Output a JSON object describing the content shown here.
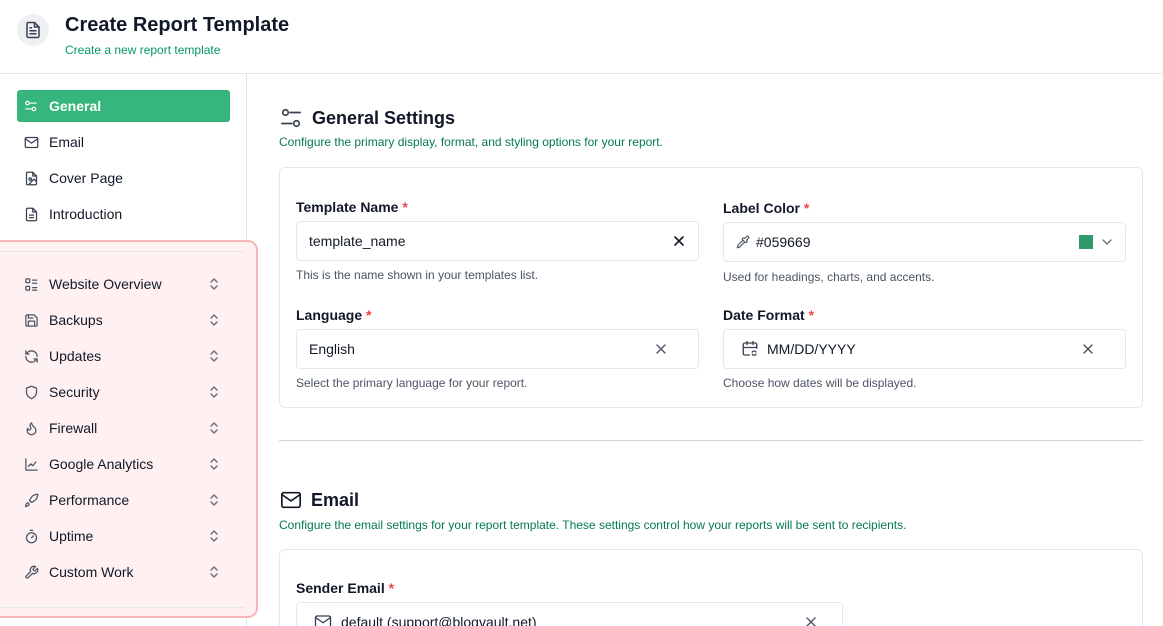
{
  "header": {
    "title": "Create Report Template",
    "subtitle": "Create a new report template"
  },
  "sidebar": {
    "top_items": [
      {
        "label": "General",
        "icon": "sliders-icon",
        "active": true
      },
      {
        "label": "Email",
        "icon": "mail-icon",
        "active": false
      },
      {
        "label": "Cover Page",
        "icon": "file-image-icon",
        "active": false
      },
      {
        "label": "Introduction",
        "icon": "file-text-icon",
        "active": false
      }
    ],
    "section_items": [
      {
        "label": "Website Overview",
        "icon": "layout-list-icon"
      },
      {
        "label": "Backups",
        "icon": "save-icon"
      },
      {
        "label": "Updates",
        "icon": "refresh-icon"
      },
      {
        "label": "Security",
        "icon": "shield-icon"
      },
      {
        "label": "Firewall",
        "icon": "flame-icon"
      },
      {
        "label": "Google Analytics",
        "icon": "chart-line-icon"
      },
      {
        "label": "Performance",
        "icon": "rocket-icon"
      },
      {
        "label": "Uptime",
        "icon": "timer-icon"
      },
      {
        "label": "Custom Work",
        "icon": "wrench-icon"
      }
    ]
  },
  "general": {
    "title": "General Settings",
    "description": "Configure the primary display, format, and styling options for your report.",
    "template_name": {
      "label": "Template Name",
      "required": "*",
      "value": "template_name",
      "help": "This is the name shown in your templates list."
    },
    "label_color": {
      "label": "Label Color",
      "required": "*",
      "value": "#059669",
      "swatch": "#2e9b6c",
      "help": "Used for headings, charts, and accents."
    },
    "language": {
      "label": "Language",
      "required": "*",
      "value": "English",
      "help": "Select the primary language for your report."
    },
    "date_format": {
      "label": "Date Format",
      "required": "*",
      "value": "MM/DD/YYYY",
      "help": "Choose how dates will be displayed."
    }
  },
  "email": {
    "title": "Email",
    "description": "Configure the email settings for your report template. These settings control how your reports will be sent to recipients.",
    "sender_email": {
      "label": "Sender Email",
      "required": "*",
      "value": "default (support@blogvault.net)"
    }
  },
  "colors": {
    "accent": "#36b67c",
    "accent_text": "#059669",
    "required": "#ef4444",
    "section_bg": "#fff1f2",
    "section_border": "#f5b5b9"
  }
}
